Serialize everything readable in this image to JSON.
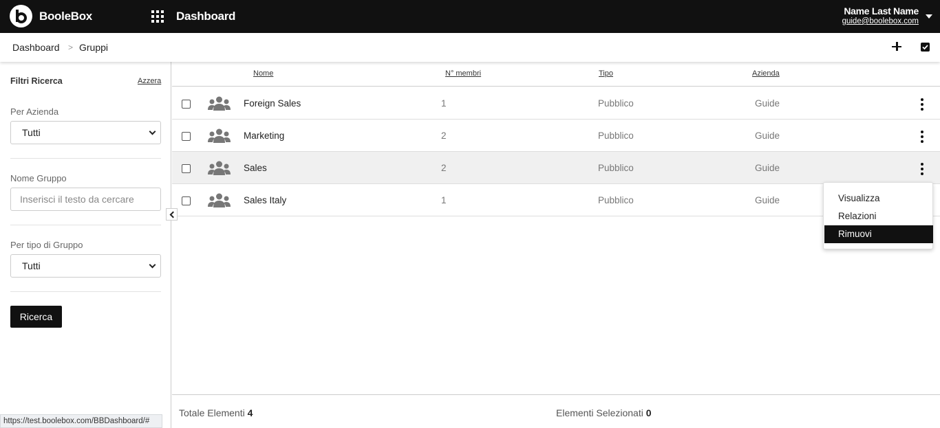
{
  "header": {
    "brand": "BooleBox",
    "title": "Dashboard",
    "user_name": "Name Last Name",
    "user_email": "guide@boolebox.com"
  },
  "breadcrumb": {
    "items": [
      "Dashboard",
      "Gruppi"
    ],
    "separator": ">"
  },
  "sidebar": {
    "title": "Filtri Ricerca",
    "reset": "Azzera",
    "company_label": "Per Azienda",
    "company_value": "Tutti",
    "name_label": "Nome Gruppo",
    "name_placeholder": "Inserisci il testo da cercare",
    "type_label": "Per tipo di Gruppo",
    "type_value": "Tutti",
    "search_button": "Ricerca"
  },
  "table": {
    "columns": [
      "Nome",
      "N° membri",
      "Tipo",
      "Azienda"
    ],
    "rows": [
      {
        "name": "Foreign Sales",
        "members": "1",
        "type": "Pubblico",
        "company": "Guide"
      },
      {
        "name": "Marketing",
        "members": "2",
        "type": "Pubblico",
        "company": "Guide"
      },
      {
        "name": "Sales",
        "members": "2",
        "type": "Pubblico",
        "company": "Guide"
      },
      {
        "name": "Sales Italy",
        "members": "1",
        "type": "Pubblico",
        "company": "Guide"
      }
    ]
  },
  "context_menu": {
    "items": [
      "Visualizza",
      "Relazioni",
      "Rimuovi"
    ],
    "highlighted": "Rimuovi"
  },
  "footer": {
    "total_label": "Totale Elementi",
    "total_value": "4",
    "selected_label": "Elementi Selezionati",
    "selected_value": "0"
  },
  "status_bar": {
    "url": "https://test.boolebox.com/BBDashboard/#"
  },
  "colors": {
    "topbar": "#111111",
    "accent": "#111111",
    "row_hover": "#f0f0f0"
  }
}
